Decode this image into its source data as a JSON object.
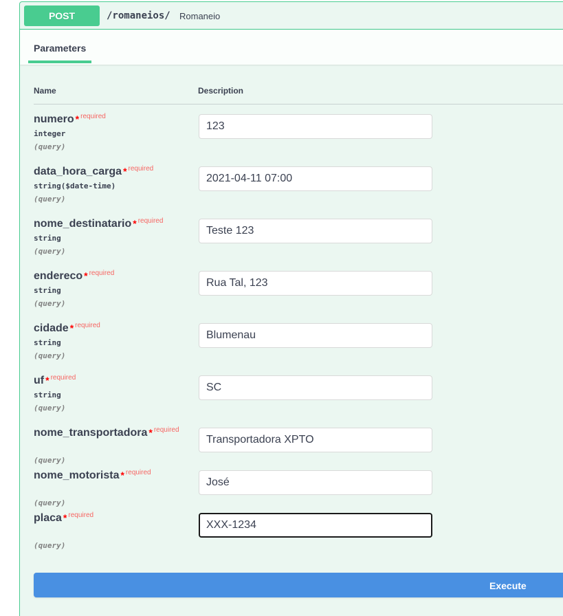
{
  "operation": {
    "method": "POST",
    "path": "/romaneios/",
    "summary": "Romaneio"
  },
  "tabs": [
    "Parameters"
  ],
  "table": {
    "name_header": "Name",
    "description_header": "Description"
  },
  "required_star": "*",
  "required_label": "required",
  "parameters": [
    {
      "name": "numero",
      "type": "integer",
      "in": "(query)",
      "value": "123"
    },
    {
      "name": "data_hora_carga",
      "type": "string($date-time)",
      "in": "(query)",
      "value": "2021-04-11 07:00"
    },
    {
      "name": "nome_destinatario",
      "type": "string",
      "in": "(query)",
      "value": "Teste 123"
    },
    {
      "name": "endereco",
      "type": "string",
      "in": "(query)",
      "value": "Rua Tal, 123"
    },
    {
      "name": "cidade",
      "type": "string",
      "in": "(query)",
      "value": "Blumenau"
    },
    {
      "name": "uf",
      "type": "string",
      "in": "(query)",
      "value": "SC"
    },
    {
      "name": "nome_transportadora",
      "type": "",
      "in": "(query)",
      "value": "Transportadora XPTO"
    },
    {
      "name": "nome_motorista",
      "type": "",
      "in": "(query)",
      "value": "José"
    },
    {
      "name": "placa",
      "type": "",
      "in": "(query)",
      "value": "XXX-1234"
    }
  ],
  "execute_label": "Execute",
  "colors": {
    "post_green": "#49cc90",
    "post_bg": "#ebf7f1",
    "execute_blue": "#4990e2",
    "required_red": "#ff0000"
  }
}
